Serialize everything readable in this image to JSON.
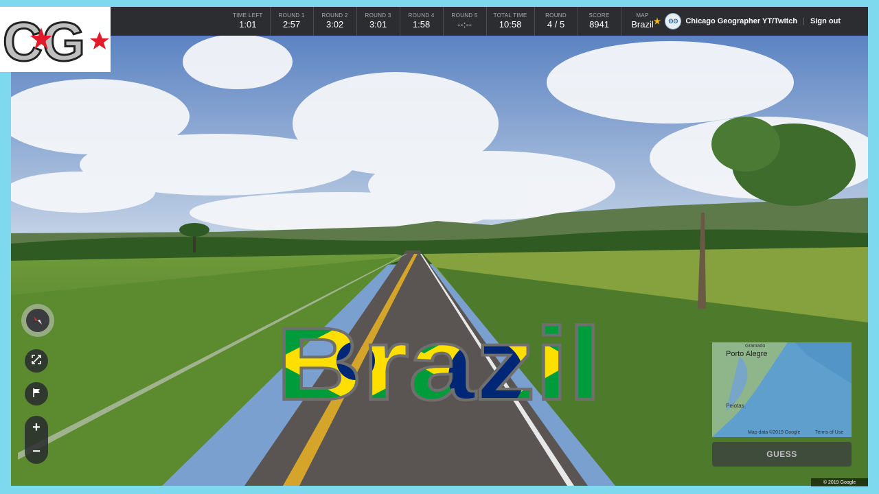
{
  "hud": {
    "stats": [
      {
        "label": "TIME LEFT",
        "value": "1:01"
      },
      {
        "label": "ROUND 1",
        "value": "2:57"
      },
      {
        "label": "ROUND 2",
        "value": "3:02"
      },
      {
        "label": "ROUND 3",
        "value": "3:01"
      },
      {
        "label": "ROUND 4",
        "value": "1:58"
      },
      {
        "label": "ROUND 5",
        "value": "--:--"
      },
      {
        "label": "TOTAL TIME",
        "value": "10:58"
      },
      {
        "label": "ROUND",
        "value": "4 / 5"
      },
      {
        "label": "SCORE",
        "value": "8941"
      },
      {
        "label": "MAP",
        "value": "Brazil"
      }
    ],
    "user_name": "Chicago Geographer YT/Twitch",
    "avatar_text": "ʘʘ",
    "separator": "|",
    "sign_out": "Sign out"
  },
  "logo": {
    "letters": "CG"
  },
  "overlay": {
    "title": "Brazil"
  },
  "minimap": {
    "city_top": "Gramado",
    "city_main": "Porto Alegre",
    "city_bottom": "Pelotas",
    "map_data": "Map data ©2019 Google",
    "terms": "Terms of Use"
  },
  "guess_label": "GUESS",
  "copyright": "© 2019 Google",
  "colors": {
    "flag_green": "#009c3b",
    "flag_yellow": "#ffdf00",
    "flag_blue": "#002776",
    "accent_star": "#f5b321"
  },
  "icons": {
    "compass": "compass-icon",
    "fullscreen": "expand-icon",
    "flag": "flag-icon",
    "zoom_in": "plus-icon",
    "zoom_out": "minus-icon"
  }
}
